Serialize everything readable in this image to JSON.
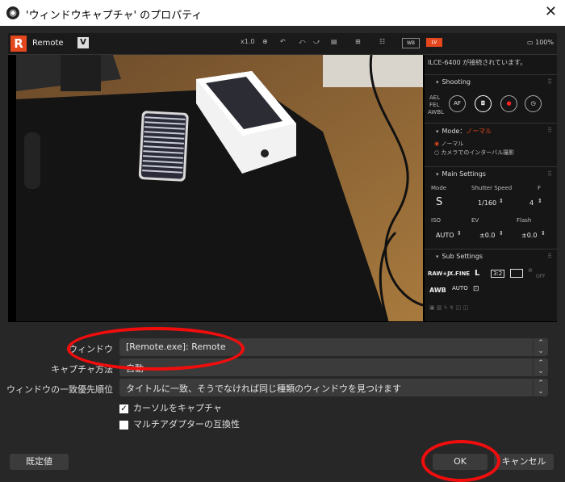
{
  "window": {
    "title": "'ウィンドウキャプチャ' のプロパティ",
    "close": "✕"
  },
  "remote": {
    "app_name": "Remote",
    "logo": "R",
    "v_badge": "V",
    "toolbar_icons": [
      "zoom-in-icon",
      "grid-icon",
      "guide-icon"
    ],
    "zoom_text": "x1.0",
    "wb_label": "WB",
    "lv_label": "LV",
    "battery_text": "100%",
    "connected_text": "ILCE-6400 が接続されています。",
    "shooting": {
      "title": "Shooting",
      "ael": "AEL",
      "fel": "FEL",
      "awbl": "AWBL",
      "af": "AF"
    },
    "mode": {
      "title": "Mode：",
      "current": "ノーマル",
      "option1": "ノーマル",
      "option2": "カメラでのインターバル撮影"
    },
    "main_settings": {
      "title": "Main Settings",
      "mode_label": "Mode",
      "mode_value": "S",
      "shutter_label": "Shutter Speed",
      "shutter_value": "1/160",
      "f_label": "F",
      "f_value": "4",
      "iso_label": "ISO",
      "iso_value": "AUTO",
      "ev_label": "EV",
      "ev_value": "±0.0",
      "flash_label": "Flash",
      "flash_value": "±0.0"
    },
    "sub_settings": {
      "title": "Sub Settings",
      "raw": "RAW+J",
      "xfine": "X.FINE",
      "size": "L",
      "aspect": "3:2",
      "off": "OFF",
      "awb": "AWB",
      "iso_auto": "AUTO"
    }
  },
  "form": {
    "window_label": "ウィンドウ",
    "window_value": "[Remote.exe]: Remote",
    "capture_method_label": "キャプチャ方法",
    "capture_method_value": "自動",
    "priority_label": "ウィンドウの一致優先順位",
    "priority_value": "タイトルに一致、そうでなければ同じ種類のウィンドウを見つけます",
    "capture_cursor_label": "カーソルをキャプチャ",
    "capture_cursor_checked": true,
    "multi_adapter_label": "マルチアダプターの互換性",
    "multi_adapter_checked": false
  },
  "buttons": {
    "defaults": "既定値",
    "ok": "OK",
    "cancel": "キャンセル"
  },
  "colors": {
    "bg": "#272727",
    "accent": "#e4461e",
    "annotation": "#f20d0d"
  }
}
